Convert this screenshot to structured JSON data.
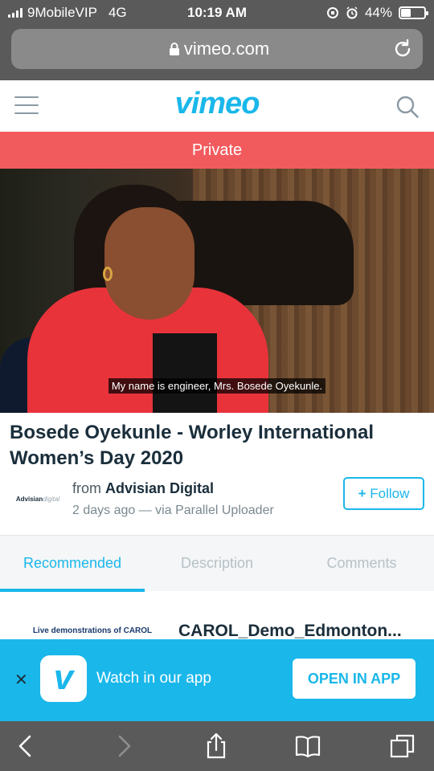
{
  "status_bar": {
    "carrier": "9MobileVIP",
    "network": "4G",
    "time": "10:19 AM",
    "battery_percent": "44%",
    "battery_level": 0.44
  },
  "browser": {
    "url": "vimeo.com"
  },
  "header": {
    "logo_text": "vimeo"
  },
  "private_banner": "Private",
  "video": {
    "subtitle": "My name is engineer, Mrs. Bosede Oyekunle."
  },
  "video_info": {
    "title": "Bosede Oyekunle - Worley International Women’s Day 2020",
    "from_prefix": "from ",
    "channel_name": "Advisian Digital",
    "channel_logo_main": "Advisian",
    "channel_logo_sub": "digital",
    "meta": "2 days ago — via Parallel Uploader",
    "follow_label": "Follow"
  },
  "tabs": [
    {
      "label": "Recommended",
      "active": true
    },
    {
      "label": "Description",
      "active": false
    },
    {
      "label": "Comments",
      "active": false
    }
  ],
  "recommended": [
    {
      "thumb_text": "Live demonstrations of CAROL",
      "title": "CAROL_Demo_Edmonton..."
    }
  ],
  "app_banner": {
    "message": "Watch in our app",
    "open_label": "OPEN IN APP",
    "app_icon_letter": "v"
  },
  "colors": {
    "vimeo_blue": "#1ab7ea",
    "private_red": "#f25b5e",
    "chrome_gray": "#5a5a5a"
  }
}
